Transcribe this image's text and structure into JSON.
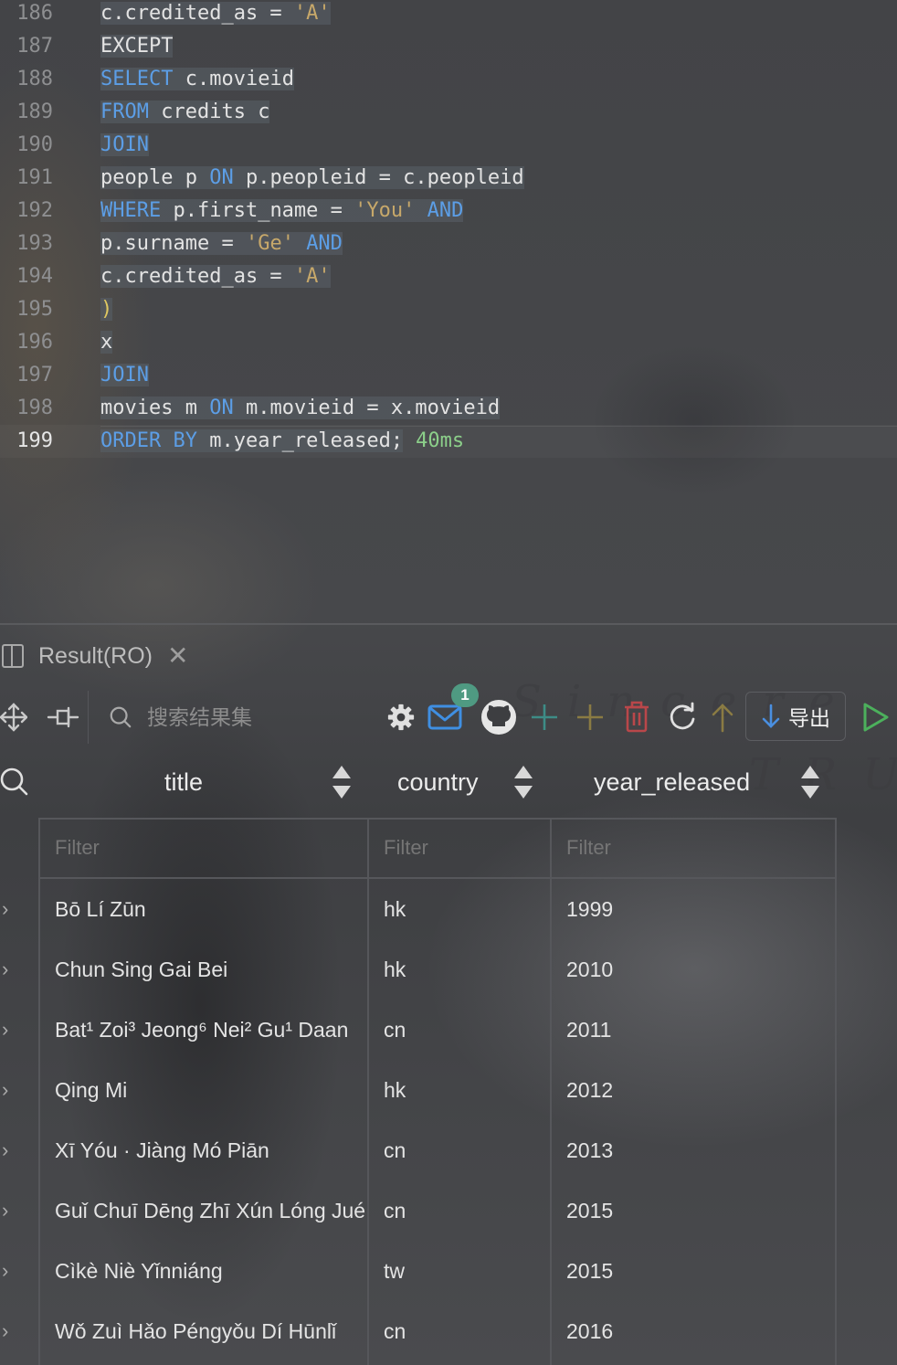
{
  "editor": {
    "lines": [
      {
        "num": "186",
        "tokens": [
          {
            "t": "c.credited_as = ",
            "c": "pl"
          },
          {
            "t": "'A'",
            "c": "str"
          }
        ]
      },
      {
        "num": "187",
        "tokens": [
          {
            "t": "EXCEPT",
            "c": "pl"
          }
        ]
      },
      {
        "num": "188",
        "tokens": [
          {
            "t": "SELECT",
            "c": "kw"
          },
          {
            "t": " c.movieid",
            "c": "pl"
          }
        ]
      },
      {
        "num": "189",
        "tokens": [
          {
            "t": "FROM",
            "c": "kw"
          },
          {
            "t": " credits c",
            "c": "pl"
          }
        ]
      },
      {
        "num": "190",
        "tokens": [
          {
            "t": "JOIN",
            "c": "kw"
          }
        ]
      },
      {
        "num": "191",
        "tokens": [
          {
            "t": "people p ",
            "c": "pl"
          },
          {
            "t": "ON",
            "c": "kw"
          },
          {
            "t": " p.peopleid = c.peopleid",
            "c": "pl"
          }
        ]
      },
      {
        "num": "192",
        "tokens": [
          {
            "t": "WHERE",
            "c": "kw"
          },
          {
            "t": " p.first_name = ",
            "c": "pl"
          },
          {
            "t": "'You'",
            "c": "str"
          },
          {
            "t": " ",
            "c": "pl"
          },
          {
            "t": "AND",
            "c": "kw"
          }
        ]
      },
      {
        "num": "193",
        "tokens": [
          {
            "t": "p.surname = ",
            "c": "pl"
          },
          {
            "t": "'Ge'",
            "c": "str"
          },
          {
            "t": " ",
            "c": "pl"
          },
          {
            "t": "AND",
            "c": "kw"
          }
        ]
      },
      {
        "num": "194",
        "tokens": [
          {
            "t": "c.credited_as = ",
            "c": "pl"
          },
          {
            "t": "'A'",
            "c": "str"
          }
        ]
      },
      {
        "num": "195",
        "tokens": [
          {
            "t": ")",
            "c": "paren"
          }
        ]
      },
      {
        "num": "196",
        "tokens": [
          {
            "t": "x",
            "c": "pl"
          }
        ]
      },
      {
        "num": "197",
        "tokens": [
          {
            "t": "JOIN",
            "c": "kw"
          }
        ]
      },
      {
        "num": "198",
        "tokens": [
          {
            "t": "movies m ",
            "c": "pl"
          },
          {
            "t": "ON",
            "c": "kw"
          },
          {
            "t": " m.movieid = x.movieid",
            "c": "pl"
          }
        ]
      },
      {
        "num": "199",
        "tokens": [
          {
            "t": "ORDER BY",
            "c": "kw"
          },
          {
            "t": " m.year_released;",
            "c": "pl"
          }
        ]
      }
    ],
    "timing": "40ms"
  },
  "result_tab": {
    "title": "Result(RO)",
    "close": "✕"
  },
  "toolbar": {
    "search_placeholder": "搜索结果集",
    "notification_count": "1",
    "export_label": "导出"
  },
  "grid": {
    "columns": [
      "title",
      "country",
      "year_released"
    ],
    "filter_placeholder": "Filter",
    "rows": [
      [
        "Bō Lí Zūn",
        "hk",
        "1999"
      ],
      [
        "Chun Sing Gai Bei",
        "hk",
        "2010"
      ],
      [
        "Bat¹ Zoi³ Jeong⁶ Nei² Gu¹ Daan",
        "cn",
        "2011"
      ],
      [
        "Qing Mi",
        "hk",
        "2012"
      ],
      [
        "Xī Yóu · Jiàng Mó Piān",
        "cn",
        "2013"
      ],
      [
        "Guǐ Chuī Dēng Zhī Xún Lóng Jué",
        "cn",
        "2015"
      ],
      [
        "Cìkè Niè Yǐnniáng",
        "tw",
        "2015"
      ],
      [
        "Wǒ Zuì Hǎo Péngyǒu Dí Hūnlǐ",
        "cn",
        "2016"
      ]
    ]
  },
  "colors": {
    "keyword": "#5c9ee6",
    "string": "#c7a86a",
    "timing": "#8ccf8a",
    "badge": "#4f9a82",
    "add_row": "#3d8c86",
    "delete_row": "#b9474a",
    "run": "#4cb05c",
    "export_arrow": "#4a8fe0"
  }
}
